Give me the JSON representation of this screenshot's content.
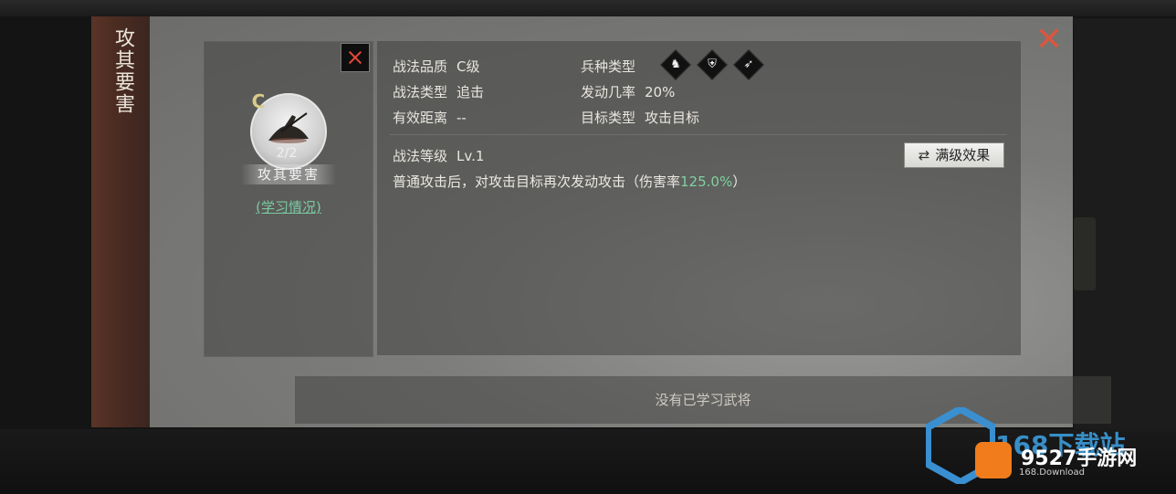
{
  "modal": {
    "title": "攻其要害",
    "close_icon": "close-x-icon"
  },
  "skill": {
    "grade_letter": "C",
    "count": "2/2",
    "name": "攻其要害",
    "study_link": "(学习情况)"
  },
  "attributes": {
    "quality_label": "战法品质",
    "quality_value": "C级",
    "type_label": "战法类型",
    "type_value": "追击",
    "range_label": "有效距离",
    "range_value": "--",
    "troop_label": "兵种类型",
    "troop_icons": [
      "cavalry-icon",
      "shield-icon",
      "archer-icon"
    ],
    "trigger_label": "发动几率",
    "trigger_value": "20%",
    "target_label": "目标类型",
    "target_value": "攻击目标"
  },
  "level": {
    "label": "战法等级",
    "value": "Lv.1",
    "button": "满级效果"
  },
  "description": {
    "prefix": "普通攻击后，对攻击目标再次发动攻击（伤害率",
    "highlight": "125.0%",
    "suffix": "）",
    "highlight_color": "#7fd0a0"
  },
  "learned": {
    "empty_text": "没有已学习武将"
  },
  "watermark": {
    "big": "168下载站",
    "main": "9527手游网",
    "sub": "168.Download"
  },
  "colors": {
    "accent_red": "#d9573f",
    "link_green": "#79c9a0",
    "title_strip": "#4c2c22"
  }
}
